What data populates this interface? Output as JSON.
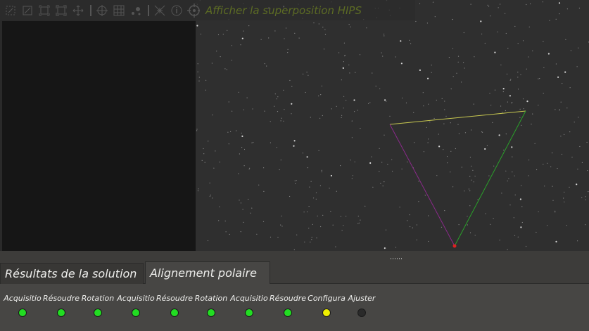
{
  "toolbar": {
    "hips_label": "Afficher la superposition HIPS",
    "icons": [
      "zoom-in-icon",
      "zoom-out-icon",
      "zoom-default-icon",
      "zoom-fit-icon",
      "pan-icon",
      "crosshair-icon",
      "grid-icon",
      "stars-icon",
      "eq-grid-icon",
      "info-icon",
      "target-icon"
    ]
  },
  "tabs": [
    {
      "label": "Résultats de la solution",
      "active": false
    },
    {
      "label": "Alignement polaire",
      "active": true
    }
  ],
  "steps": [
    {
      "label": "Acquisitio",
      "color": "#22dd22"
    },
    {
      "label": "Résoudre",
      "color": "#22dd22"
    },
    {
      "label": "Rotation",
      "color": "#22dd22"
    },
    {
      "label": "Acquisitio",
      "color": "#22dd22"
    },
    {
      "label": "Résoudre",
      "color": "#22dd22"
    },
    {
      "label": "Rotation",
      "color": "#22dd22"
    },
    {
      "label": "Acquisitio",
      "color": "#22dd22"
    },
    {
      "label": "Résoudre",
      "color": "#22dd22"
    },
    {
      "label": "Configura",
      "color": "#f0f000"
    },
    {
      "label": "Ajuster",
      "color": "#2a2a2a"
    }
  ],
  "colors": {
    "triangle_top": "#c8c850",
    "triangle_right": "#2aa02a",
    "triangle_left": "#8a2a8a",
    "marker": "#dd2222"
  }
}
